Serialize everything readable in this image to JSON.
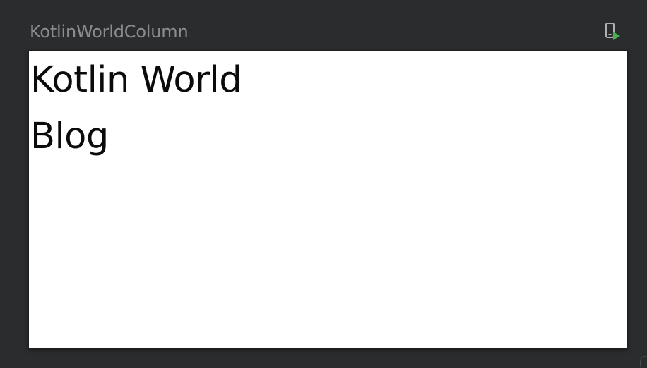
{
  "preview": {
    "title": "KotlinWorldColumn",
    "deploy_icon": "deploy-to-device-icon",
    "accent_color": "#4caf50"
  },
  "column": {
    "texts": [
      "Kotlin World",
      "Blog"
    ]
  }
}
